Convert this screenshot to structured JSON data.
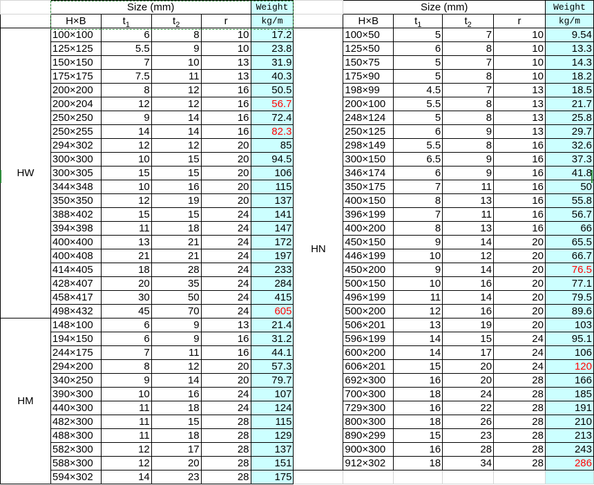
{
  "header": {
    "size_label": "Size (mm)",
    "weight_line1": "Weight",
    "weight_line2": "kg/m",
    "col_hb": "H×B",
    "col_t1": "t",
    "col_t1_sub": "1",
    "col_t2": "t",
    "col_t2_sub": "2",
    "col_r": "r"
  },
  "left_groups": [
    {
      "label": "HW",
      "rows": [
        {
          "hb": "100×100",
          "t1": "6",
          "t2": "8",
          "r": "10",
          "w": "17.2",
          "red": false
        },
        {
          "hb": "125×125",
          "t1": "5.5",
          "t2": "9",
          "r": "10",
          "w": "23.8",
          "red": false
        },
        {
          "hb": "150×150",
          "t1": "7",
          "t2": "10",
          "r": "13",
          "w": "31.9",
          "red": false
        },
        {
          "hb": "175×175",
          "t1": "7.5",
          "t2": "11",
          "r": "13",
          "w": "40.3",
          "red": false
        },
        {
          "hb": "200×200",
          "t1": "8",
          "t2": "12",
          "r": "16",
          "w": "50.5",
          "red": false
        },
        {
          "hb": "200×204",
          "t1": "12",
          "t2": "12",
          "r": "16",
          "w": "56.7",
          "red": true
        },
        {
          "hb": "250×250",
          "t1": "9",
          "t2": "14",
          "r": "16",
          "w": "72.4",
          "red": false
        },
        {
          "hb": "250×255",
          "t1": "14",
          "t2": "14",
          "r": "16",
          "w": "82.3",
          "red": true
        },
        {
          "hb": "294×302",
          "t1": "12",
          "t2": "12",
          "r": "20",
          "w": "85",
          "red": false
        },
        {
          "hb": "300×300",
          "t1": "10",
          "t2": "15",
          "r": "20",
          "w": "94.5",
          "red": false
        },
        {
          "hb": "300×305",
          "t1": "15",
          "t2": "15",
          "r": "20",
          "w": "106",
          "red": false
        },
        {
          "hb": "344×348",
          "t1": "10",
          "t2": "16",
          "r": "20",
          "w": "115",
          "red": false
        },
        {
          "hb": "350×350",
          "t1": "12",
          "t2": "19",
          "r": "20",
          "w": "137",
          "red": false
        },
        {
          "hb": "388×402",
          "t1": "15",
          "t2": "15",
          "r": "24",
          "w": "141",
          "red": false
        },
        {
          "hb": "394×398",
          "t1": "11",
          "t2": "18",
          "r": "24",
          "w": "147",
          "red": false
        },
        {
          "hb": "400×400",
          "t1": "13",
          "t2": "21",
          "r": "24",
          "w": "172",
          "red": false
        },
        {
          "hb": "400×408",
          "t1": "21",
          "t2": "21",
          "r": "24",
          "w": "197",
          "red": false
        },
        {
          "hb": "414×405",
          "t1": "18",
          "t2": "28",
          "r": "24",
          "w": "233",
          "red": false
        },
        {
          "hb": "428×407",
          "t1": "20",
          "t2": "35",
          "r": "24",
          "w": "284",
          "red": false
        },
        {
          "hb": "458×417",
          "t1": "30",
          "t2": "50",
          "r": "24",
          "w": "415",
          "red": false
        },
        {
          "hb": "498×432",
          "t1": "45",
          "t2": "70",
          "r": "24",
          "w": "605",
          "red": true
        }
      ]
    },
    {
      "label": "HM",
      "rows": [
        {
          "hb": "148×100",
          "t1": "6",
          "t2": "9",
          "r": "13",
          "w": "21.4",
          "red": false
        },
        {
          "hb": "194×150",
          "t1": "6",
          "t2": "9",
          "r": "16",
          "w": "31.2",
          "red": false
        },
        {
          "hb": "244×175",
          "t1": "7",
          "t2": "11",
          "r": "16",
          "w": "44.1",
          "red": false
        },
        {
          "hb": "294×200",
          "t1": "8",
          "t2": "12",
          "r": "20",
          "w": "57.3",
          "red": false
        },
        {
          "hb": "340×250",
          "t1": "9",
          "t2": "14",
          "r": "20",
          "w": "79.7",
          "red": false
        },
        {
          "hb": "390×300",
          "t1": "10",
          "t2": "16",
          "r": "24",
          "w": "107",
          "red": false
        },
        {
          "hb": "440×300",
          "t1": "11",
          "t2": "18",
          "r": "24",
          "w": "124",
          "red": false
        },
        {
          "hb": "482×300",
          "t1": "11",
          "t2": "15",
          "r": "28",
          "w": "115",
          "red": false
        },
        {
          "hb": "488×300",
          "t1": "11",
          "t2": "18",
          "r": "28",
          "w": "129",
          "red": false
        },
        {
          "hb": "582×300",
          "t1": "12",
          "t2": "17",
          "r": "28",
          "w": "137",
          "red": false
        },
        {
          "hb": "588×300",
          "t1": "12",
          "t2": "20",
          "r": "28",
          "w": "151",
          "red": false
        },
        {
          "hb": "594×302",
          "t1": "14",
          "t2": "23",
          "r": "28",
          "w": "175",
          "red": false
        }
      ]
    }
  ],
  "right_group": {
    "label": "HN",
    "rows": [
      {
        "hb": "100×50",
        "t1": "5",
        "t2": "7",
        "r": "10",
        "w": "9.54",
        "red": false
      },
      {
        "hb": "125×50",
        "t1": "6",
        "t2": "8",
        "r": "10",
        "w": "13.3",
        "red": false
      },
      {
        "hb": "150×75",
        "t1": "5",
        "t2": "7",
        "r": "10",
        "w": "14.3",
        "red": false
      },
      {
        "hb": "175×90",
        "t1": "5",
        "t2": "8",
        "r": "10",
        "w": "18.2",
        "red": false
      },
      {
        "hb": "198×99",
        "t1": "4.5",
        "t2": "7",
        "r": "13",
        "w": "18.5",
        "red": false
      },
      {
        "hb": "200×100",
        "t1": "5.5",
        "t2": "8",
        "r": "13",
        "w": "21.7",
        "red": false
      },
      {
        "hb": "248×124",
        "t1": "5",
        "t2": "8",
        "r": "13",
        "w": "25.8",
        "red": false
      },
      {
        "hb": "250×125",
        "t1": "6",
        "t2": "9",
        "r": "13",
        "w": "29.7",
        "red": false
      },
      {
        "hb": "298×149",
        "t1": "5.5",
        "t2": "8",
        "r": "16",
        "w": "32.6",
        "red": false
      },
      {
        "hb": "300×150",
        "t1": "6.5",
        "t2": "9",
        "r": "16",
        "w": "37.3",
        "red": false
      },
      {
        "hb": "346×174",
        "t1": "6",
        "t2": "9",
        "r": "16",
        "w": "41.8",
        "red": false
      },
      {
        "hb": "350×175",
        "t1": "7",
        "t2": "11",
        "r": "16",
        "w": "50",
        "red": false
      },
      {
        "hb": "400×150",
        "t1": "8",
        "t2": "13",
        "r": "16",
        "w": "55.8",
        "red": false
      },
      {
        "hb": "396×199",
        "t1": "7",
        "t2": "11",
        "r": "16",
        "w": "56.7",
        "red": false
      },
      {
        "hb": "400×200",
        "t1": "8",
        "t2": "13",
        "r": "16",
        "w": "66",
        "red": false
      },
      {
        "hb": "450×150",
        "t1": "9",
        "t2": "14",
        "r": "20",
        "w": "65.5",
        "red": false
      },
      {
        "hb": "446×199",
        "t1": "10",
        "t2": "12",
        "r": "20",
        "w": "66.7",
        "red": false
      },
      {
        "hb": "450×200",
        "t1": "9",
        "t2": "14",
        "r": "20",
        "w": "76.5",
        "red": true
      },
      {
        "hb": "500×150",
        "t1": "10",
        "t2": "16",
        "r": "20",
        "w": "77.1",
        "red": false
      },
      {
        "hb": "496×199",
        "t1": "11",
        "t2": "14",
        "r": "20",
        "w": "79.5",
        "red": false
      },
      {
        "hb": "500×200",
        "t1": "12",
        "t2": "16",
        "r": "20",
        "w": "89.6",
        "red": false
      },
      {
        "hb": "506×201",
        "t1": "13",
        "t2": "19",
        "r": "20",
        "w": "103",
        "red": false
      },
      {
        "hb": "596×199",
        "t1": "14",
        "t2": "15",
        "r": "24",
        "w": "95.1",
        "red": false
      },
      {
        "hb": "600×200",
        "t1": "14",
        "t2": "17",
        "r": "24",
        "w": "106",
        "red": false
      },
      {
        "hb": "606×201",
        "t1": "15",
        "t2": "20",
        "r": "24",
        "w": "120",
        "red": true
      },
      {
        "hb": "692×300",
        "t1": "16",
        "t2": "20",
        "r": "28",
        "w": "166",
        "red": false
      },
      {
        "hb": "700×300",
        "t1": "18",
        "t2": "24",
        "r": "28",
        "w": "185",
        "red": false
      },
      {
        "hb": "729×300",
        "t1": "16",
        "t2": "22",
        "r": "28",
        "w": "191",
        "red": false
      },
      {
        "hb": "800×300",
        "t1": "18",
        "t2": "26",
        "r": "28",
        "w": "210",
        "red": false
      },
      {
        "hb": "890×299",
        "t1": "15",
        "t2": "23",
        "r": "28",
        "w": "213",
        "red": false
      },
      {
        "hb": "900×300",
        "t1": "16",
        "t2": "28",
        "r": "28",
        "w": "243",
        "red": false
      },
      {
        "hb": "912×302",
        "t1": "18",
        "t2": "34",
        "r": "28",
        "w": "286",
        "red": true
      }
    ]
  }
}
